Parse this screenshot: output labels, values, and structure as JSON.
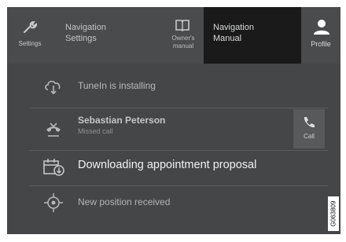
{
  "topbar": {
    "settings_label": "Settings",
    "nav_settings_line1": "Navigation",
    "nav_settings_line2": "Settings",
    "owners_manual_line1": "Owner's",
    "owners_manual_line2": "manual",
    "nav_manual_line1": "Navigation",
    "nav_manual_line2": "Manual",
    "profile_label": "Profile",
    "active_item": "Navigation Manual"
  },
  "notifications": [
    {
      "icon": "download-cloud-icon",
      "title": "TuneIn is installing"
    },
    {
      "icon": "missed-call-icon",
      "title": "Sebastian Peterson",
      "subtitle": "Missed call",
      "action_label": "Call"
    },
    {
      "icon": "calendar-download-icon",
      "title": "Downloading appointment proposal"
    },
    {
      "icon": "position-target-icon",
      "title": "New position received"
    }
  ],
  "image_code": "G063809",
  "colors": {
    "screen_bg": "#454647",
    "active_tab_bg": "#1a1a1b",
    "highlight_text": "#f2f2f2"
  }
}
